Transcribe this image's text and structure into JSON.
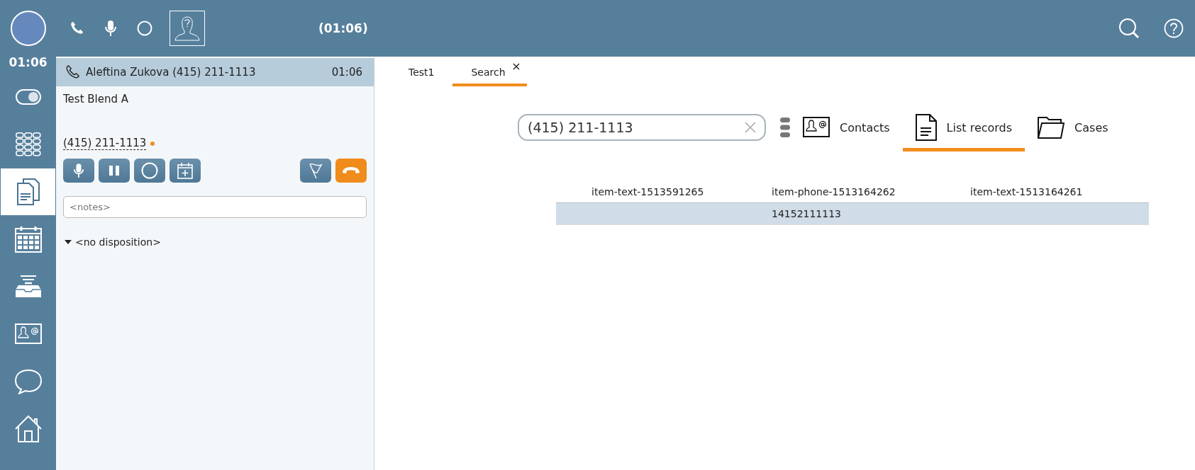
{
  "top_bar": {
    "timer": "(01:06)"
  },
  "rail": {
    "time": "01:06",
    "items": [
      {
        "kind": "toggle",
        "selected": false
      },
      {
        "kind": "dialpad",
        "selected": false
      },
      {
        "kind": "documents",
        "selected": true
      },
      {
        "kind": "calendar",
        "selected": false
      },
      {
        "kind": "inbox",
        "selected": false
      },
      {
        "kind": "contacts",
        "selected": false
      },
      {
        "kind": "chat",
        "selected": false
      },
      {
        "kind": "home",
        "selected": false
      }
    ]
  },
  "call": {
    "caller": "Aleftina Zukova (415) 211-1113",
    "duration": "01:06",
    "campaign": "Test Blend A",
    "phone": "(415) 211-1113",
    "notes_placeholder": "<notes>",
    "disposition": "<no disposition>"
  },
  "tabs": [
    {
      "label": "Test1",
      "selected": false
    },
    {
      "label": "Search",
      "selected": true,
      "close": "×"
    }
  ],
  "search": {
    "value": "(415) 211-1113"
  },
  "sources": [
    {
      "kind": "contacts",
      "label": "Contacts",
      "selected": false
    },
    {
      "kind": "list",
      "label": "List records",
      "selected": true
    },
    {
      "kind": "cases",
      "label": "Cases",
      "selected": false
    }
  ],
  "table": {
    "columns": [
      "item-text-1513591265",
      "item-phone-1513164262",
      "item-text-1513164261"
    ],
    "rows": [
      {
        "selected": true,
        "cells": [
          null,
          "14152111113",
          null
        ]
      }
    ]
  }
}
